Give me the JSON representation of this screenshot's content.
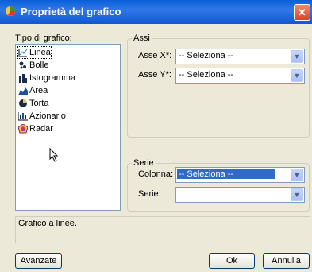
{
  "window": {
    "title": "Proprietà del grafico",
    "close_glyph": "✕"
  },
  "chart_type": {
    "label": "Tipo di grafico:",
    "items": [
      {
        "label": "Linea",
        "icon": "line-chart-icon"
      },
      {
        "label": "Bolle",
        "icon": "bubble-chart-icon"
      },
      {
        "label": "Istogramma",
        "icon": "bar-chart-icon"
      },
      {
        "label": "Area",
        "icon": "area-chart-icon"
      },
      {
        "label": "Torta",
        "icon": "pie-chart-icon"
      },
      {
        "label": "Azionario",
        "icon": "stock-chart-icon"
      },
      {
        "label": "Radar",
        "icon": "radar-chart-icon"
      }
    ],
    "selected": "Linea"
  },
  "axes": {
    "legend": "Assi",
    "x_label": "Asse X*:",
    "x_value": "-- Seleziona --",
    "y_label": "Asse Y*:",
    "y_value": "-- Seleziona --"
  },
  "series": {
    "legend": "Serie",
    "column_label": "Colonna:",
    "column_value": "-- Seleziona --",
    "series_label": "Serie:",
    "series_value": ""
  },
  "description": "Grafico a linee.",
  "buttons": {
    "advanced": "Avanzate",
    "ok": "Ok",
    "cancel": "Annulla"
  },
  "colors": {
    "title_bar": "#0a5fd8",
    "selection": "#316ac5",
    "background": "#ece9d8"
  }
}
